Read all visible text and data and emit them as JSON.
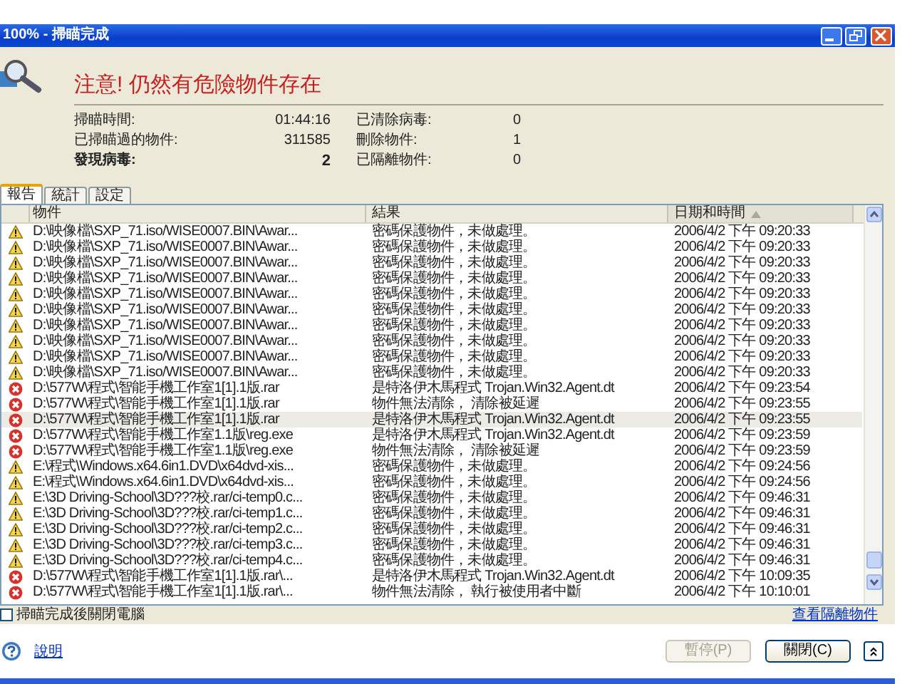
{
  "window": {
    "title": "100% - 掃瞄完成"
  },
  "header": {
    "heading": "注意! 仍然有危險物件存在",
    "stats": [
      {
        "label": "掃瞄時間:",
        "value": "01:44:16",
        "bold": false
      },
      {
        "label": "已清除病毒:",
        "value": "0",
        "bold": false
      },
      {
        "label": "已掃瞄過的物件:",
        "value": "311585",
        "bold": false
      },
      {
        "label": "刪除物件:",
        "value": "1",
        "bold": false
      },
      {
        "label": "發現病毒:",
        "value": "2",
        "bold": true
      },
      {
        "label": "已隔離物件:",
        "value": "0",
        "bold": false
      }
    ]
  },
  "tabs": [
    {
      "label": "報告",
      "selected": true
    },
    {
      "label": "統計",
      "selected": false
    },
    {
      "label": "設定",
      "selected": false
    }
  ],
  "table": {
    "columns": [
      {
        "label": "物件",
        "sorted": false
      },
      {
        "label": "結果",
        "sorted": false
      },
      {
        "label": "日期和時間",
        "sorted": true
      }
    ],
    "rows": [
      {
        "kind": "warning",
        "object": "D:\\映像檔\\SXP_71.iso/WISE0007.BIN\\Awar...",
        "result": "密碼保護物件，未做處理。",
        "time": "2006/4/2 下午 09:20:33",
        "selected": false
      },
      {
        "kind": "warning",
        "object": "D:\\映像檔\\SXP_71.iso/WISE0007.BIN\\Awar...",
        "result": "密碼保護物件，未做處理。",
        "time": "2006/4/2 下午 09:20:33",
        "selected": false
      },
      {
        "kind": "warning",
        "object": "D:\\映像檔\\SXP_71.iso/WISE0007.BIN\\Awar...",
        "result": "密碼保護物件，未做處理。",
        "time": "2006/4/2 下午 09:20:33",
        "selected": false
      },
      {
        "kind": "warning",
        "object": "D:\\映像檔\\SXP_71.iso/WISE0007.BIN\\Awar...",
        "result": "密碼保護物件，未做處理。",
        "time": "2006/4/2 下午 09:20:33",
        "selected": false
      },
      {
        "kind": "warning",
        "object": "D:\\映像檔\\SXP_71.iso/WISE0007.BIN\\Awar...",
        "result": "密碼保護物件，未做處理。",
        "time": "2006/4/2 下午 09:20:33",
        "selected": false
      },
      {
        "kind": "warning",
        "object": "D:\\映像檔\\SXP_71.iso/WISE0007.BIN\\Awar...",
        "result": "密碼保護物件，未做處理。",
        "time": "2006/4/2 下午 09:20:33",
        "selected": false
      },
      {
        "kind": "warning",
        "object": "D:\\映像檔\\SXP_71.iso/WISE0007.BIN\\Awar...",
        "result": "密碼保護物件，未做處理。",
        "time": "2006/4/2 下午 09:20:33",
        "selected": false
      },
      {
        "kind": "warning",
        "object": "D:\\映像檔\\SXP_71.iso/WISE0007.BIN\\Awar...",
        "result": "密碼保護物件，未做處理。",
        "time": "2006/4/2 下午 09:20:33",
        "selected": false
      },
      {
        "kind": "warning",
        "object": "D:\\映像檔\\SXP_71.iso/WISE0007.BIN\\Awar...",
        "result": "密碼保護物件，未做處理。",
        "time": "2006/4/2 下午 09:20:33",
        "selected": false
      },
      {
        "kind": "warning",
        "object": "D:\\映像檔\\SXP_71.iso/WISE0007.BIN\\Awar...",
        "result": "密碼保護物件，未做處理。",
        "time": "2006/4/2 下午 09:20:33",
        "selected": false
      },
      {
        "kind": "error",
        "object": "D:\\577W\\程式\\智能手機工作室1[1].1版.rar",
        "result": "是特洛伊木馬程式  Trojan.Win32.Agent.dt",
        "time": "2006/4/2 下午 09:23:54",
        "selected": false
      },
      {
        "kind": "error",
        "object": "D:\\577W\\程式\\智能手機工作室1[1].1版.rar",
        "result": "物件無法清除， 清除被延遲",
        "time": "2006/4/2 下午 09:23:55",
        "selected": false
      },
      {
        "kind": "error",
        "object": "D:\\577W\\程式\\智能手機工作室1[1].1版.rar",
        "result": "是特洛伊木馬程式  Trojan.Win32.Agent.dt",
        "time": "2006/4/2 下午 09:23:55",
        "selected": true
      },
      {
        "kind": "error",
        "object": "D:\\577W\\程式\\智能手機工作室1.1版\\reg.exe",
        "result": "是特洛伊木馬程式  Trojan.Win32.Agent.dt",
        "time": "2006/4/2 下午 09:23:59",
        "selected": false
      },
      {
        "kind": "error",
        "object": "D:\\577W\\程式\\智能手機工作室1.1版\\reg.exe",
        "result": "物件無法清除， 清除被延遲",
        "time": "2006/4/2 下午 09:23:59",
        "selected": false
      },
      {
        "kind": "warning",
        "object": "E:\\程式\\Windows.x64.6in1.DVD\\x64dvd-xis...",
        "result": "密碼保護物件，未做處理。",
        "time": "2006/4/2 下午 09:24:56",
        "selected": false
      },
      {
        "kind": "warning",
        "object": "E:\\程式\\Windows.x64.6in1.DVD\\x64dvd-xis...",
        "result": "密碼保護物件，未做處理。",
        "time": "2006/4/2 下午 09:24:56",
        "selected": false
      },
      {
        "kind": "warning",
        "object": "E:\\3D Driving-School\\3D???校.rar/ci-temp0.c...",
        "result": "密碼保護物件，未做處理。",
        "time": "2006/4/2 下午 09:46:31",
        "selected": false
      },
      {
        "kind": "warning",
        "object": "E:\\3D Driving-School\\3D???校.rar/ci-temp1.c...",
        "result": "密碼保護物件，未做處理。",
        "time": "2006/4/2 下午 09:46:31",
        "selected": false
      },
      {
        "kind": "warning",
        "object": "E:\\3D Driving-School\\3D???校.rar/ci-temp2.c...",
        "result": "密碼保護物件，未做處理。",
        "time": "2006/4/2 下午 09:46:31",
        "selected": false
      },
      {
        "kind": "warning",
        "object": "E:\\3D Driving-School\\3D???校.rar/ci-temp3.c...",
        "result": "密碼保護物件，未做處理。",
        "time": "2006/4/2 下午 09:46:31",
        "selected": false
      },
      {
        "kind": "warning",
        "object": "E:\\3D Driving-School\\3D???校.rar/ci-temp4.c...",
        "result": "密碼保護物件，未做處理。",
        "time": "2006/4/2 下午 09:46:31",
        "selected": false
      },
      {
        "kind": "error",
        "object": "D:\\577W\\程式\\智能手機工作室1[1].1版.rar\\...",
        "result": "是特洛伊木馬程式  Trojan.Win32.Agent.dt",
        "time": "2006/4/2 下午 10:09:35",
        "selected": false
      },
      {
        "kind": "error",
        "object": "D:\\577W\\程式\\智能手機工作室1[1].1版.rar\\...",
        "result": "物件無法清除， 執行被使用者中斷",
        "time": "2006/4/2 下午 10:10:01",
        "selected": false
      }
    ]
  },
  "options": {
    "shutdown_checkbox": {
      "label": "掃瞄完成後關閉電腦",
      "checked": false
    },
    "quarantine_link": "查看隔離物件"
  },
  "footer": {
    "help_link": "說明",
    "buttons": [
      {
        "label": "暫停(P)",
        "disabled": true
      },
      {
        "label": "關閉(C)",
        "disabled": false
      }
    ]
  }
}
